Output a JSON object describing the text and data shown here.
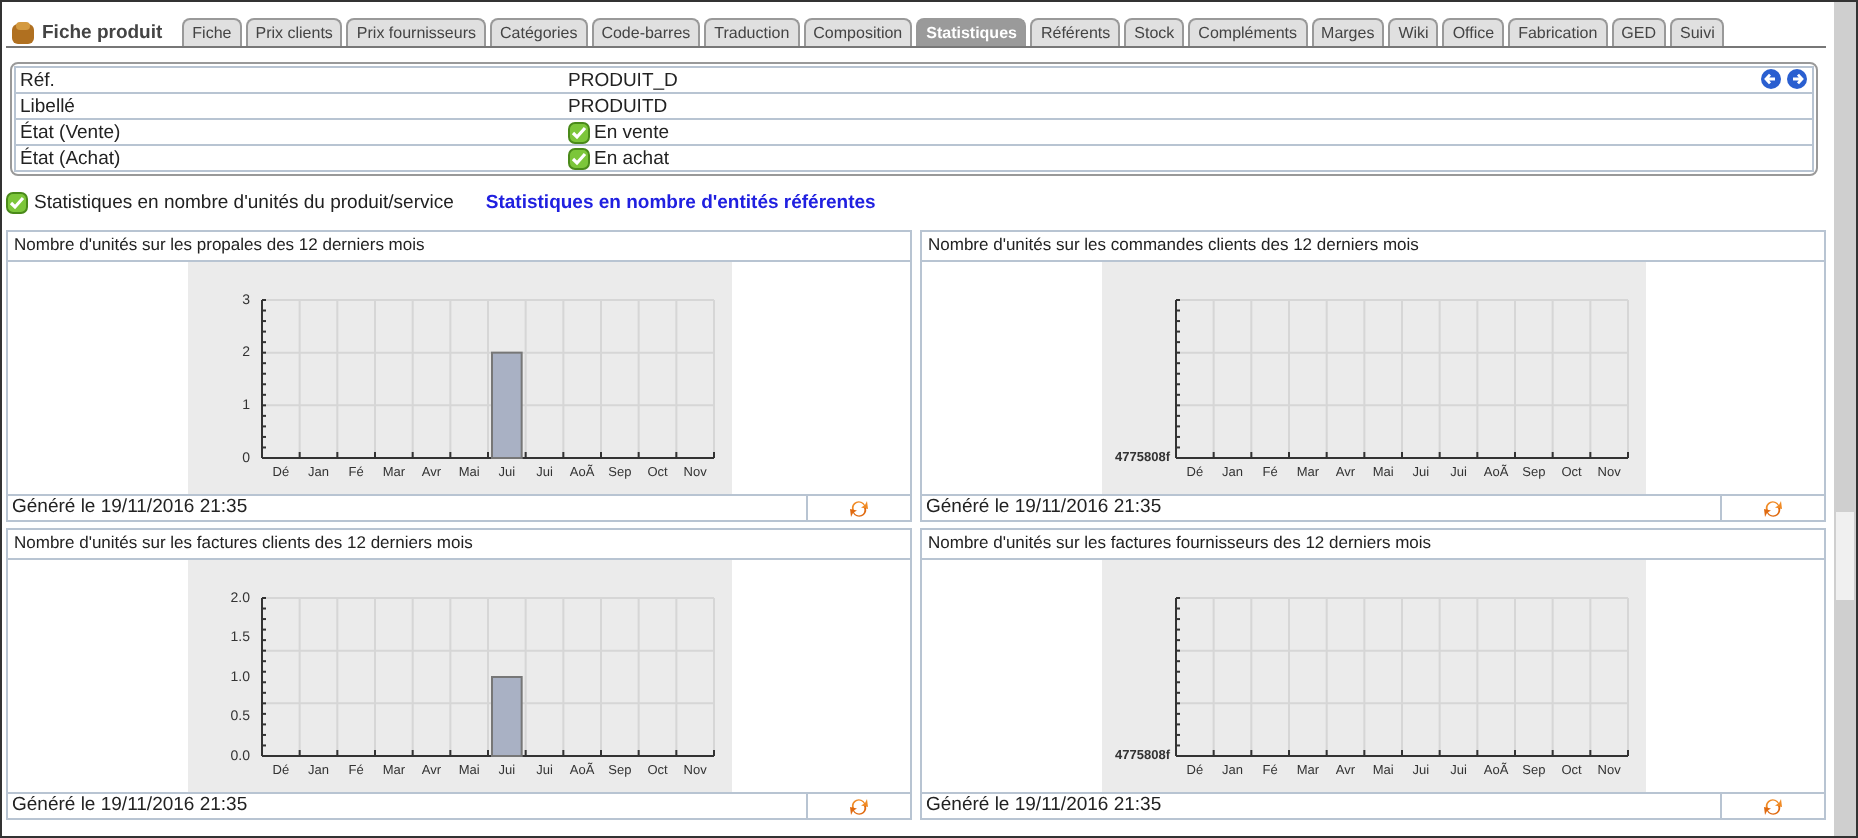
{
  "header": {
    "title": "Fiche produit"
  },
  "tabs": [
    {
      "label": "Fiche",
      "selected": false
    },
    {
      "label": "Prix clients",
      "selected": false
    },
    {
      "label": "Prix fournisseurs",
      "selected": false
    },
    {
      "label": "Catégories",
      "selected": false
    },
    {
      "label": "Code-barres",
      "selected": false
    },
    {
      "label": "Traduction",
      "selected": false
    },
    {
      "label": "Composition",
      "selected": false
    },
    {
      "label": "Statistiques",
      "selected": true
    },
    {
      "label": "Référents",
      "selected": false
    },
    {
      "label": "Stock",
      "selected": false
    },
    {
      "label": "Compléments",
      "selected": false
    },
    {
      "label": "Marges",
      "selected": false
    },
    {
      "label": "Wiki",
      "selected": false
    },
    {
      "label": "Office",
      "selected": false
    },
    {
      "label": "Fabrication",
      "selected": false
    },
    {
      "label": "GED",
      "selected": false
    },
    {
      "label": "Suivi",
      "selected": false
    }
  ],
  "info": [
    {
      "label": "Réf.",
      "value": "PRODUIT_D",
      "kind": "text"
    },
    {
      "label": "Libellé",
      "value": "PRODUITD",
      "kind": "text"
    },
    {
      "label": "État (Vente)",
      "value": "En vente",
      "kind": "status",
      "on": true
    },
    {
      "label": "État (Achat)",
      "value": "En achat",
      "kind": "status",
      "on": true
    }
  ],
  "modes": [
    {
      "label": "Statistiques en nombre d'unités du produit/service",
      "selected": true
    },
    {
      "label": "Statistiques en nombre d'entités référentes",
      "selected": false
    }
  ],
  "panels": [
    {
      "title": "Nombre d'unités sur les propales des 12 derniers mois",
      "footer": "Généré le 19/11/2016 21:35",
      "chart_data": {
        "type": "bar",
        "categories": [
          "Dé",
          "Jan",
          "Fé",
          "Mar",
          "Avr",
          "Mai",
          "Jui",
          "Jui",
          "AoÃ",
          "Sep",
          "Oct",
          "Nov"
        ],
        "values": [
          0,
          0,
          0,
          0,
          0,
          0,
          2,
          0,
          0,
          0,
          0,
          0
        ],
        "ylim": [
          0,
          3
        ],
        "yticks": [
          0,
          1,
          2,
          3
        ]
      }
    },
    {
      "title": "Nombre d'unités sur les commandes clients des 12 derniers mois",
      "footer": "Généré le 19/11/2016 21:35",
      "chart_data": {
        "type": "other",
        "categories": [
          "Dé",
          "Jan",
          "Fé",
          "Mar",
          "Avr",
          "Mai",
          "Jui",
          "Jui",
          "AoÃ",
          "Sep",
          "Oct",
          "Nov"
        ],
        "annotations": [
          {
            "text": "4775808f"
          }
        ]
      }
    },
    {
      "title": "Nombre d'unités sur les factures clients des 12 derniers mois",
      "footer": "Généré le 19/11/2016 21:35",
      "chart_data": {
        "type": "bar",
        "categories": [
          "Dé",
          "Jan",
          "Fé",
          "Mar",
          "Avr",
          "Mai",
          "Jui",
          "Jui",
          "AoÃ",
          "Sep",
          "Oct",
          "Nov"
        ],
        "values": [
          0,
          0,
          0,
          0,
          0,
          0,
          1,
          0,
          0,
          0,
          0,
          0
        ],
        "ylim": [
          0,
          2
        ],
        "yticks": [
          {
            "value": 0,
            "label": "0.0"
          },
          {
            "value": 0.5,
            "label": "0.5"
          },
          {
            "value": 1,
            "label": "1.0"
          },
          {
            "value": 1.5,
            "label": "1.5"
          },
          {
            "value": 2,
            "label": "2.0"
          }
        ]
      }
    },
    {
      "title": "Nombre d'unités sur les factures fournisseurs des 12 derniers mois",
      "footer": "Généré le 19/11/2016 21:35",
      "chart_data": {
        "type": "other",
        "categories": [
          "Dé",
          "Jan",
          "Fé",
          "Mar",
          "Avr",
          "Mai",
          "Jui",
          "Jui",
          "AoÃ",
          "Sep",
          "Oct",
          "Nov"
        ],
        "annotations": [
          {
            "text": "4775808f"
          }
        ]
      }
    }
  ]
}
